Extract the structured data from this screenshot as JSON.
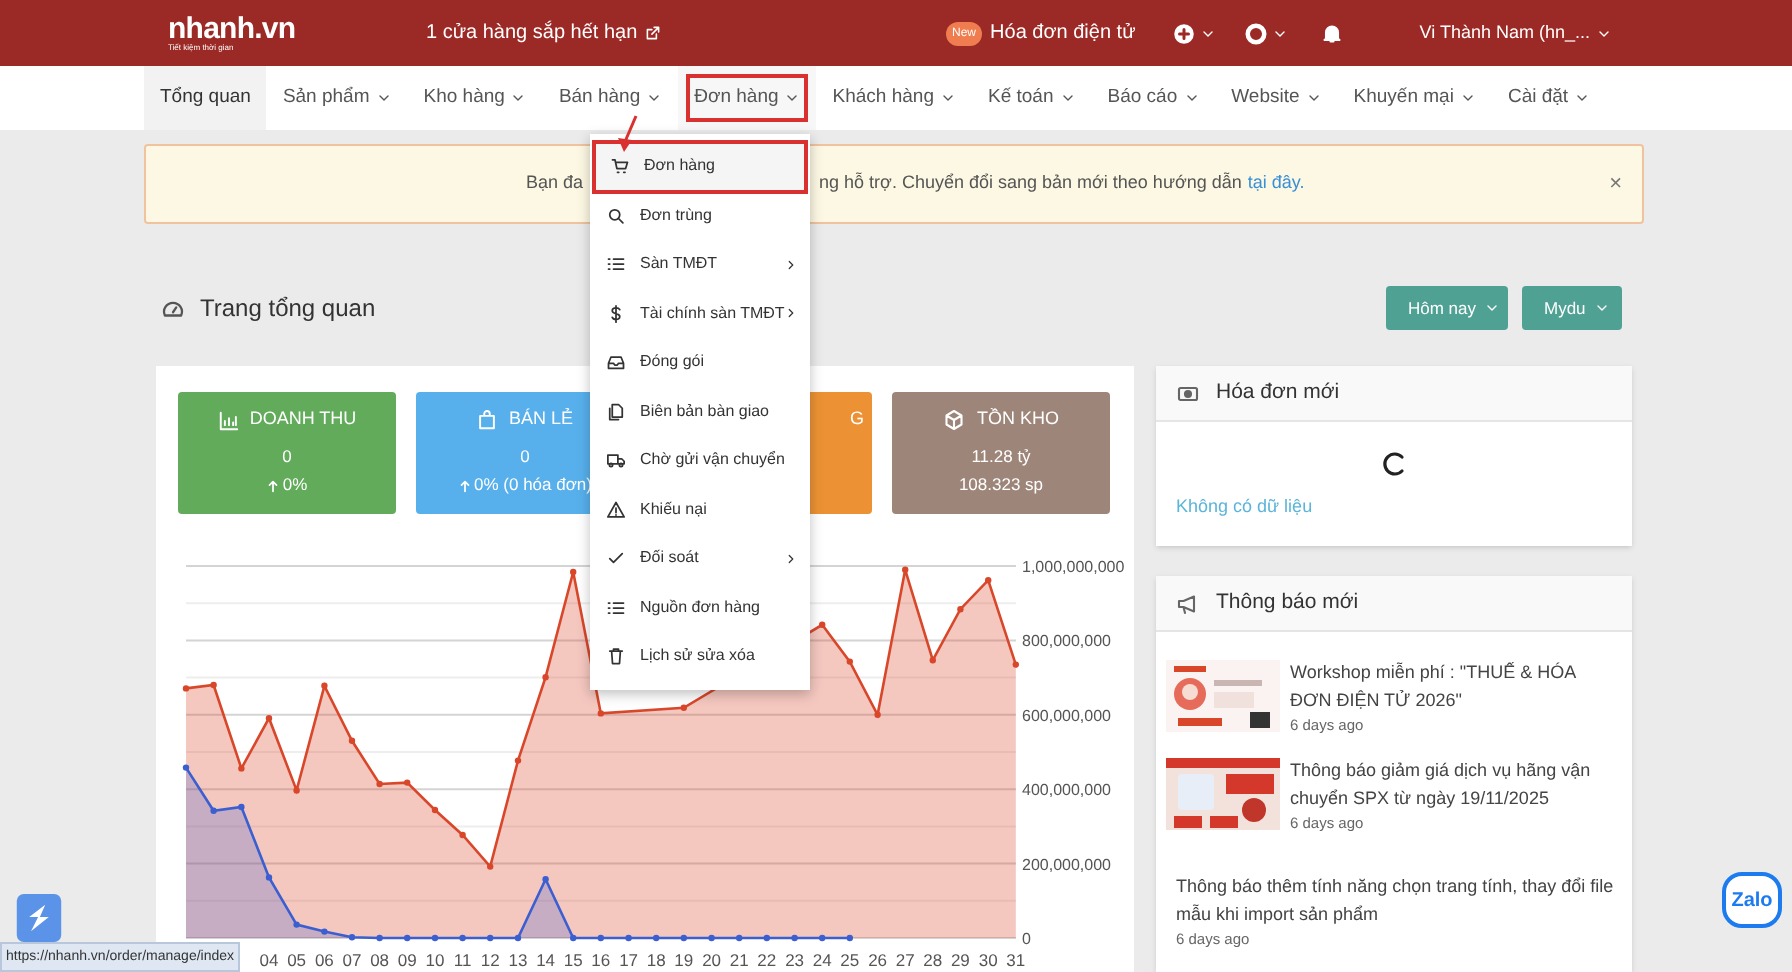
{
  "header": {
    "logo": {
      "name": "nhanh.vn",
      "tagline": "Tiết kiệm thời gian"
    },
    "notice": "1 cửa hàng sắp hết hạn",
    "badge": "New",
    "e_invoice": "Hóa đơn điện tử",
    "user": "Vi Thành Nam (hn_..."
  },
  "nav": [
    {
      "label": "Tổng quan",
      "selected": true,
      "dropdown": false,
      "highlighted": false
    },
    {
      "label": "Sản phẩm",
      "selected": false,
      "dropdown": true,
      "highlighted": false
    },
    {
      "label": "Kho hàng",
      "selected": false,
      "dropdown": true,
      "highlighted": false
    },
    {
      "label": "Bán hàng",
      "selected": false,
      "dropdown": true,
      "highlighted": false
    },
    {
      "label": "Đơn hàng",
      "selected": false,
      "dropdown": true,
      "highlighted": true
    },
    {
      "label": "Khách hàng",
      "selected": false,
      "dropdown": true,
      "highlighted": false
    },
    {
      "label": "Kế toán",
      "selected": false,
      "dropdown": true,
      "highlighted": false
    },
    {
      "label": "Báo cáo",
      "selected": false,
      "dropdown": true,
      "highlighted": false
    },
    {
      "label": "Website",
      "selected": false,
      "dropdown": true,
      "highlighted": false
    },
    {
      "label": "Khuyến mại",
      "selected": false,
      "dropdown": true,
      "highlighted": false
    },
    {
      "label": "Cài đặt",
      "selected": false,
      "dropdown": true,
      "highlighted": false
    }
  ],
  "menu": [
    {
      "label": "Đơn hàng",
      "submenu": false,
      "highlighted": true
    },
    {
      "label": "Đơn trùng",
      "submenu": false,
      "highlighted": false
    },
    {
      "label": "Sàn TMĐT",
      "submenu": true,
      "highlighted": false
    },
    {
      "label": "Tài chính sàn TMĐT",
      "submenu": true,
      "highlighted": false
    },
    {
      "label": "Đóng gói",
      "submenu": false,
      "highlighted": false
    },
    {
      "label": "Biên bản bàn giao",
      "submenu": false,
      "highlighted": false
    },
    {
      "label": "Chờ gửi vận chuyển",
      "submenu": false,
      "highlighted": false
    },
    {
      "label": "Khiếu nại",
      "submenu": false,
      "highlighted": false
    },
    {
      "label": "Đối soát",
      "submenu": true,
      "highlighted": false
    },
    {
      "label": "Nguồn đơn hàng",
      "submenu": false,
      "highlighted": false
    },
    {
      "label": "Lịch sử sửa xóa",
      "submenu": false,
      "highlighted": false
    }
  ],
  "alert": {
    "text_start": "Bạn đa",
    "text_end": "ng hỗ trợ. Chuyển đổi sang bản mới theo hướng dẫn",
    "link": "tại đây.",
    "close": "×"
  },
  "page_title": "Trang tổng quan",
  "filters": [
    "Hôm nay",
    "Mydu"
  ],
  "stat_cards": [
    {
      "title": "DOANH THU",
      "value": "0",
      "change": "0%",
      "color": "#62ab5b"
    },
    {
      "title": "BÁN LẺ",
      "value": "0",
      "change": "0% (0 hóa đơn)",
      "color": "#57b0ec"
    },
    {
      "title": "G",
      "color": "#ec9234"
    },
    {
      "title": "TỒN KHO",
      "value": "11.28 tỷ",
      "change": "108.323 sp",
      "color": "#9e8579"
    }
  ],
  "chart_data": {
    "type": "area",
    "grid": true,
    "categories": [
      null,
      null,
      null,
      "04",
      "05",
      "06",
      "07",
      "08",
      "09",
      "10",
      "11",
      "12",
      "13",
      "14",
      "15",
      "16",
      "17",
      "18",
      "19",
      "20",
      "21",
      "22",
      "23",
      "24",
      "25",
      "26",
      "27",
      "28",
      "29",
      "30",
      "31"
    ],
    "series": [
      {
        "color": "#d9472b",
        "values": [
          671000000,
          680000000,
          456000000,
          591000000,
          397000000,
          678000000,
          530000000,
          414000000,
          418000000,
          344000000,
          277000000,
          192000000,
          477000000,
          701000000,
          984000000,
          604000000,
          null,
          null,
          619000000,
          null,
          null,
          null,
          null,
          842000000,
          743000000,
          600000000,
          990000000,
          747000000,
          884000000,
          962000000,
          735000000
        ]
      },
      {
        "color": "#3b5fd0",
        "values": [
          458000000,
          342000000,
          352000000,
          163000000,
          36000000,
          17000000,
          2000000,
          0,
          0,
          0,
          0,
          0,
          0,
          158000000,
          0,
          0,
          0,
          0,
          0,
          0,
          0,
          0,
          0,
          0,
          0,
          null,
          null,
          null,
          null,
          null,
          null
        ]
      }
    ],
    "ylim": [
      0,
      1000000000
    ],
    "yticks": [
      {
        "value": 0,
        "label": "0"
      },
      {
        "value": 200000000,
        "label": "200,000,000"
      },
      {
        "value": 400000000,
        "label": "400,000,000"
      },
      {
        "value": 600000000,
        "label": "600,000,000"
      },
      {
        "value": 800000000,
        "label": "800,000,000"
      },
      {
        "value": 1000000000,
        "label": "1,000,000,000"
      }
    ]
  },
  "invoices": {
    "title": "Hóa đơn mới",
    "empty": "Không có dữ liệu"
  },
  "news": {
    "title": "Thông báo mới",
    "items": [
      {
        "title": "Workshop miễn phí : \"THUẾ & HÓA ĐƠN ĐIỆN TỬ 2026\"",
        "time": "6 days ago",
        "kind": "picture"
      },
      {
        "title": "Thông báo giảm giá dịch vụ hãng vận chuyển SPX từ ngày 19/11/2025",
        "time": "6 days ago",
        "kind": "picture"
      },
      {
        "title": "Thông báo thêm tính năng chọn trang tính, thay đổi file mẫu khi import sản phẩm",
        "time": "6 days ago",
        "kind": "text"
      }
    ]
  },
  "status_url": "https://nhanh.vn/order/manage/index",
  "zalo": "Zalo"
}
